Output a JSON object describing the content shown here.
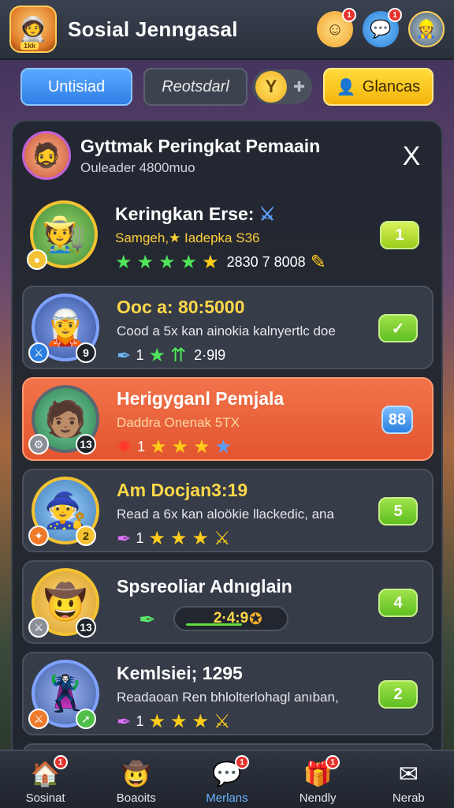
{
  "header": {
    "title": "Sosial Jenngasal",
    "logo_tag": "1kk",
    "face_badge": "1",
    "chat_badge": "1",
    "icons": [
      "smiley-icon",
      "chat-icon",
      "user-avatar"
    ]
  },
  "toolbar": {
    "tab_active": "Untisiad",
    "tab_inactive": "Reotsdarl",
    "toggle_glyph": "Y",
    "yellow_button": "Glancas"
  },
  "panel": {
    "title": "Gyttmak Peringkat Pemaain",
    "subtitle": "Ouleader 4800muo",
    "close_glyph": "X"
  },
  "rows": [
    {
      "name": "Keringkan Erse:",
      "detail": "Samgeh,★ Iadepka S36",
      "level": "",
      "score": "2830 7 8008",
      "rank": "1"
    },
    {
      "name": "Ooc a: 80:5000",
      "detail": "Cood a 5x kan ainokia kalnyertlc doe",
      "level": "9",
      "count": "1",
      "score": "2·9l9",
      "rank": "✓"
    },
    {
      "name": "Herigyganl Pemjala",
      "detail": "Daddra Onenak 5TX",
      "level": "13",
      "count": "1",
      "rank": "88"
    },
    {
      "name": "Am Docjan3:19",
      "detail": "Read a 6x kan aloökie llackedic, ana",
      "level": "2",
      "count": "1",
      "rank": "5"
    },
    {
      "name": "Spsreoliar Adnıglain",
      "detail": "",
      "level": "13",
      "progress": "2·4:9",
      "progress_fraction": 0.6,
      "rank": "4"
    },
    {
      "name": "Kemlsiei; 1295",
      "detail": "Readaoan Ren bhlolterlohagl anıban,",
      "level": "",
      "count": "1",
      "rank": "2"
    }
  ],
  "bottom_nav": [
    {
      "label": "Sosinat",
      "icon": "home-icon",
      "badge": "1"
    },
    {
      "label": "Boaoits",
      "icon": "character-icon",
      "badge": ""
    },
    {
      "label": "Merlans",
      "icon": "chat-icon",
      "badge": "1"
    },
    {
      "label": "Nendly",
      "icon": "gift-icon",
      "badge": "1"
    },
    {
      "label": "Nerab",
      "icon": "mail-icon",
      "badge": ""
    }
  ],
  "colors": {
    "accent_blue": "#2f7fe6",
    "accent_yellow": "#f5b50a",
    "highlight_row": "#e2552f",
    "rank_green": "#5fbf21"
  }
}
